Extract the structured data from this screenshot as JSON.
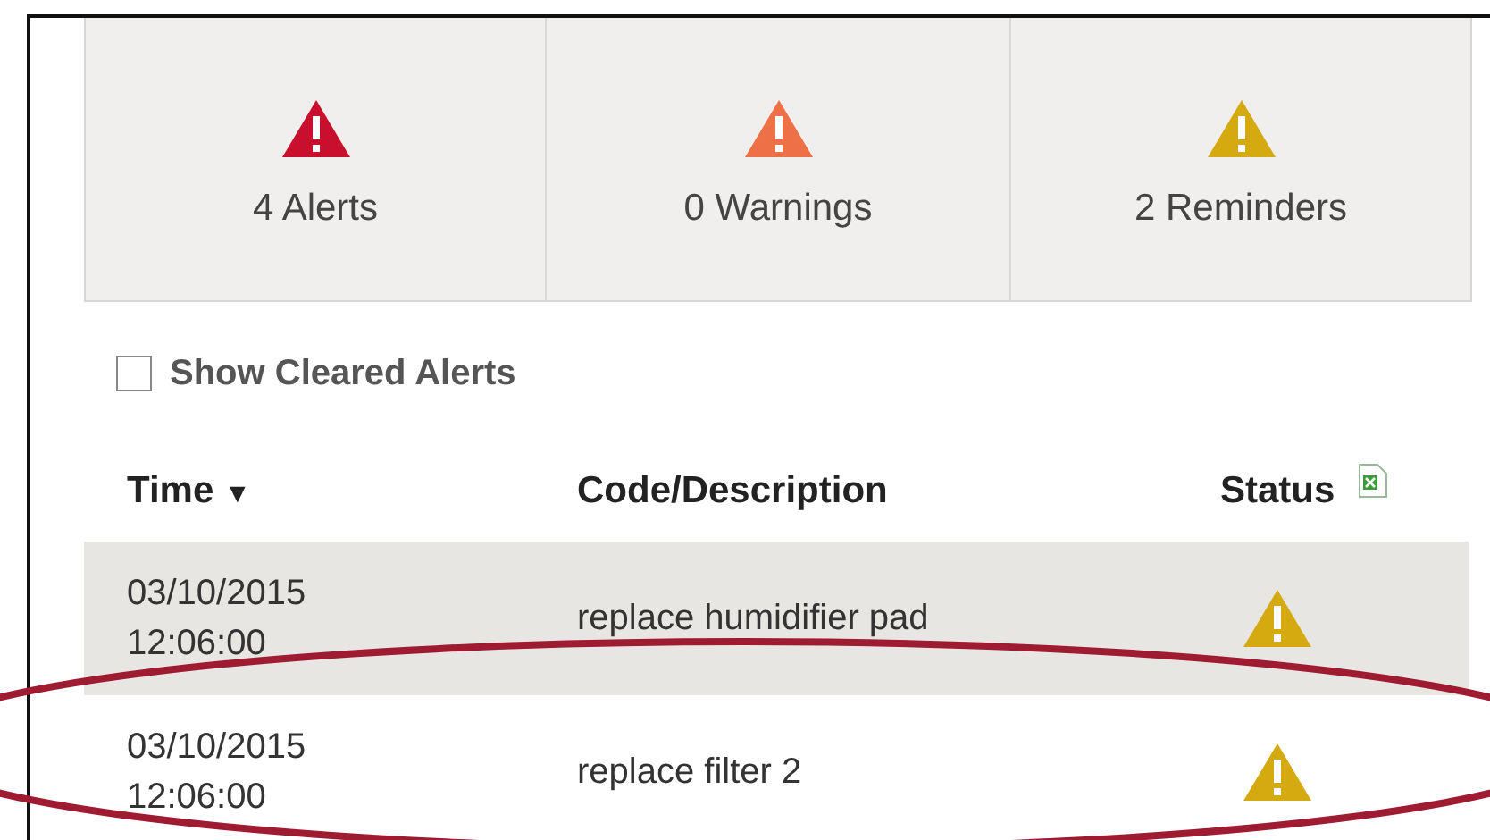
{
  "summary": [
    {
      "label": "4 Alerts",
      "color": "#c8102e"
    },
    {
      "label": "0 Warnings",
      "color": "#ee7047"
    },
    {
      "label": "2 Reminders",
      "color": "#d4aa10"
    }
  ],
  "show_cleared": {
    "label": "Show Cleared Alerts",
    "checked": false
  },
  "table": {
    "columns": [
      {
        "label": "Time",
        "sort": "▼"
      },
      {
        "label": "Code/Description"
      },
      {
        "label": "Status"
      }
    ],
    "rows": [
      {
        "date": "03/10/2015",
        "time": "12:06:00",
        "description": "replace humidifier pad",
        "color": "#d4aa10"
      },
      {
        "date": "03/10/2015",
        "time": "12:06:00",
        "description": "replace filter 2",
        "color": "#d4aa10"
      }
    ]
  }
}
